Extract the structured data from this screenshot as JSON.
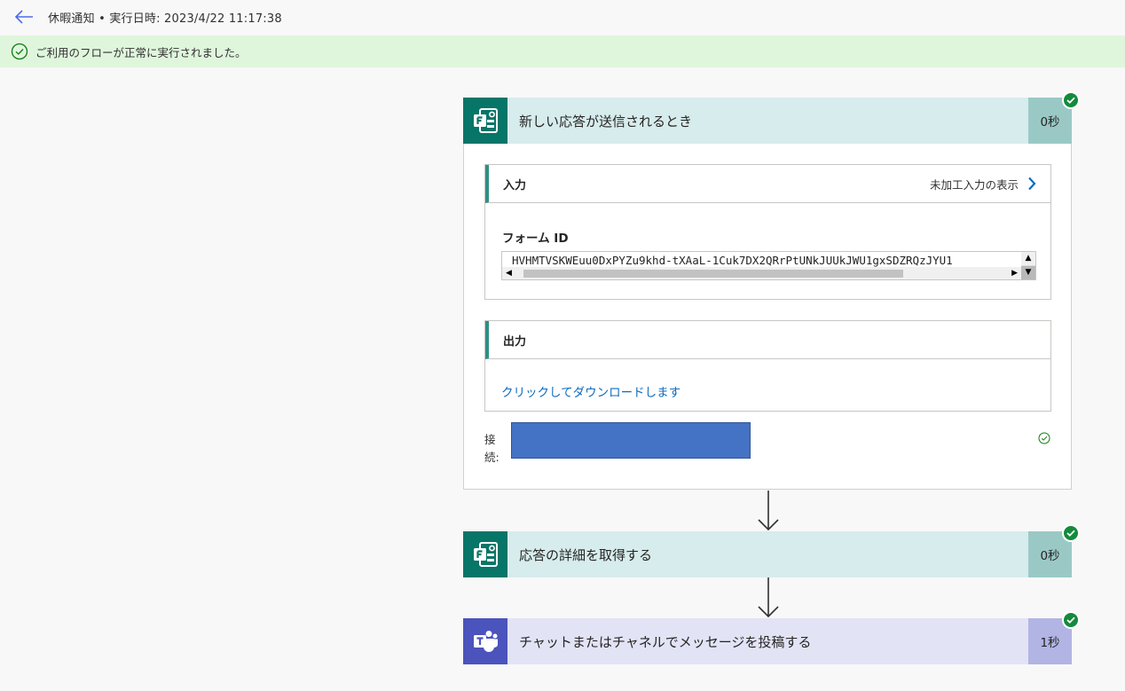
{
  "topbar": {
    "back_icon": "arrow-left-icon",
    "run_title": "休暇通知 • 実行日時: 2023/4/22 11:17:38"
  },
  "banner": {
    "icon": "check-circle-icon",
    "message": "ご利用のフローが正常に実行されました。",
    "color": "#dff6dd"
  },
  "steps": [
    {
      "title": "新しい応答が送信されるとき",
      "duration": "0秒",
      "app": "forms",
      "status": "succeeded",
      "inputs": {
        "section_label": "入力",
        "raw_link": "未加工入力の表示",
        "field_label": "フォーム ID",
        "field_value": "HVHMTVSKWEuu0DxPYZu9khd-tXAaL-1Cuk7DX2QRrPtUNkJUUkJWU1gxSDZRQzJYU1"
      },
      "outputs": {
        "section_label": "出力",
        "download_link": "クリックしてダウンロードします"
      },
      "connection": {
        "label": "接続:",
        "value_redacted": true
      }
    },
    {
      "title": "応答の詳細を取得する",
      "duration": "0秒",
      "app": "forms",
      "status": "succeeded"
    },
    {
      "title": "チャットまたはチャネルでメッセージを投稿する",
      "duration": "1秒",
      "app": "teams",
      "status": "succeeded"
    }
  ],
  "colors": {
    "forms_brand": "#077568",
    "teams_brand": "#4b53bc",
    "success": "#138a3c",
    "link": "#0f6cbd"
  }
}
